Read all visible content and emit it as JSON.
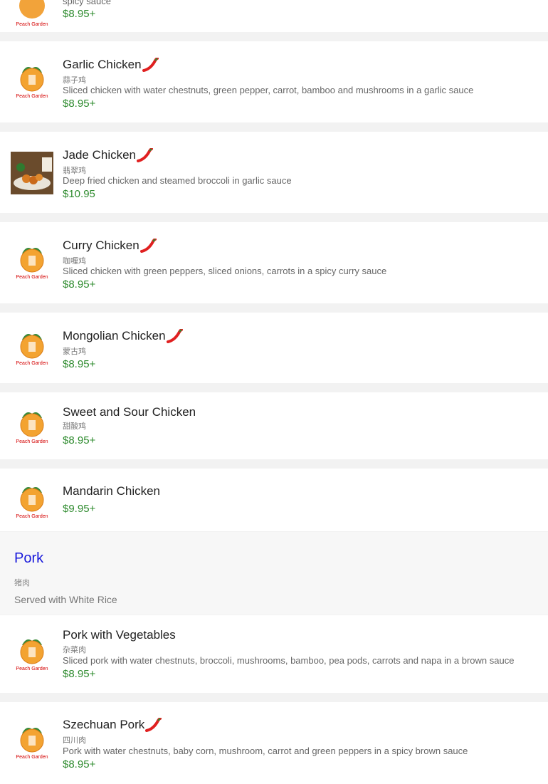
{
  "top_partial": {
    "desc": "spicy sauce",
    "price": "$8.95+"
  },
  "items": [
    {
      "name": "Garlic Chicken",
      "cn": "蒜子鸡",
      "desc": "Sliced chicken with water chestnuts, green pepper, carrot, bamboo and mushrooms in a garlic sauce",
      "price": "$8.95+",
      "spicy": true,
      "image": "logo"
    },
    {
      "name": "Jade Chicken",
      "cn": "翡翠鸡",
      "desc": "Deep fried chicken and steamed broccoli in garlic sauce",
      "price": "$10.95",
      "spicy": true,
      "image": "photo"
    },
    {
      "name": "Curry Chicken",
      "cn": "咖喱鸡",
      "desc": "Sliced chicken with green peppers, sliced onions, carrots in a spicy curry sauce",
      "price": "$8.95+",
      "spicy": true,
      "image": "logo"
    },
    {
      "name": "Mongolian Chicken",
      "cn": "蒙古鸡",
      "desc": "",
      "price": "$8.95+",
      "spicy": true,
      "image": "logo"
    },
    {
      "name": "Sweet and Sour Chicken",
      "cn": "甜酸鸡",
      "desc": "",
      "price": "$8.95+",
      "spicy": false,
      "image": "logo"
    },
    {
      "name": "Mandarin Chicken",
      "cn": "",
      "desc": "",
      "price": "$9.95+",
      "spicy": false,
      "image": "logo"
    }
  ],
  "section": {
    "title": "Pork",
    "cn": "猪肉",
    "note": "Served with White Rice"
  },
  "pork_items": [
    {
      "name": "Pork with Vegetables",
      "cn": "杂菜肉",
      "desc": "Sliced pork with water chestnuts, broccoli, mushrooms, bamboo, pea pods, carrots and napa in a brown sauce",
      "price": "$8.95+",
      "spicy": false,
      "image": "logo"
    },
    {
      "name": "Szechuan Pork",
      "cn": "四川肉",
      "desc": "Pork with water chestnuts, baby corn, mushroom, carrot and green peppers in a spicy brown sauce",
      "price": "$8.95+",
      "spicy": true,
      "image": "logo"
    }
  ],
  "logo_text": "Peach Garden",
  "colors": {
    "price": "#2e8b2e",
    "section_title": "#1a1adb",
    "pepper": "#e02020"
  }
}
